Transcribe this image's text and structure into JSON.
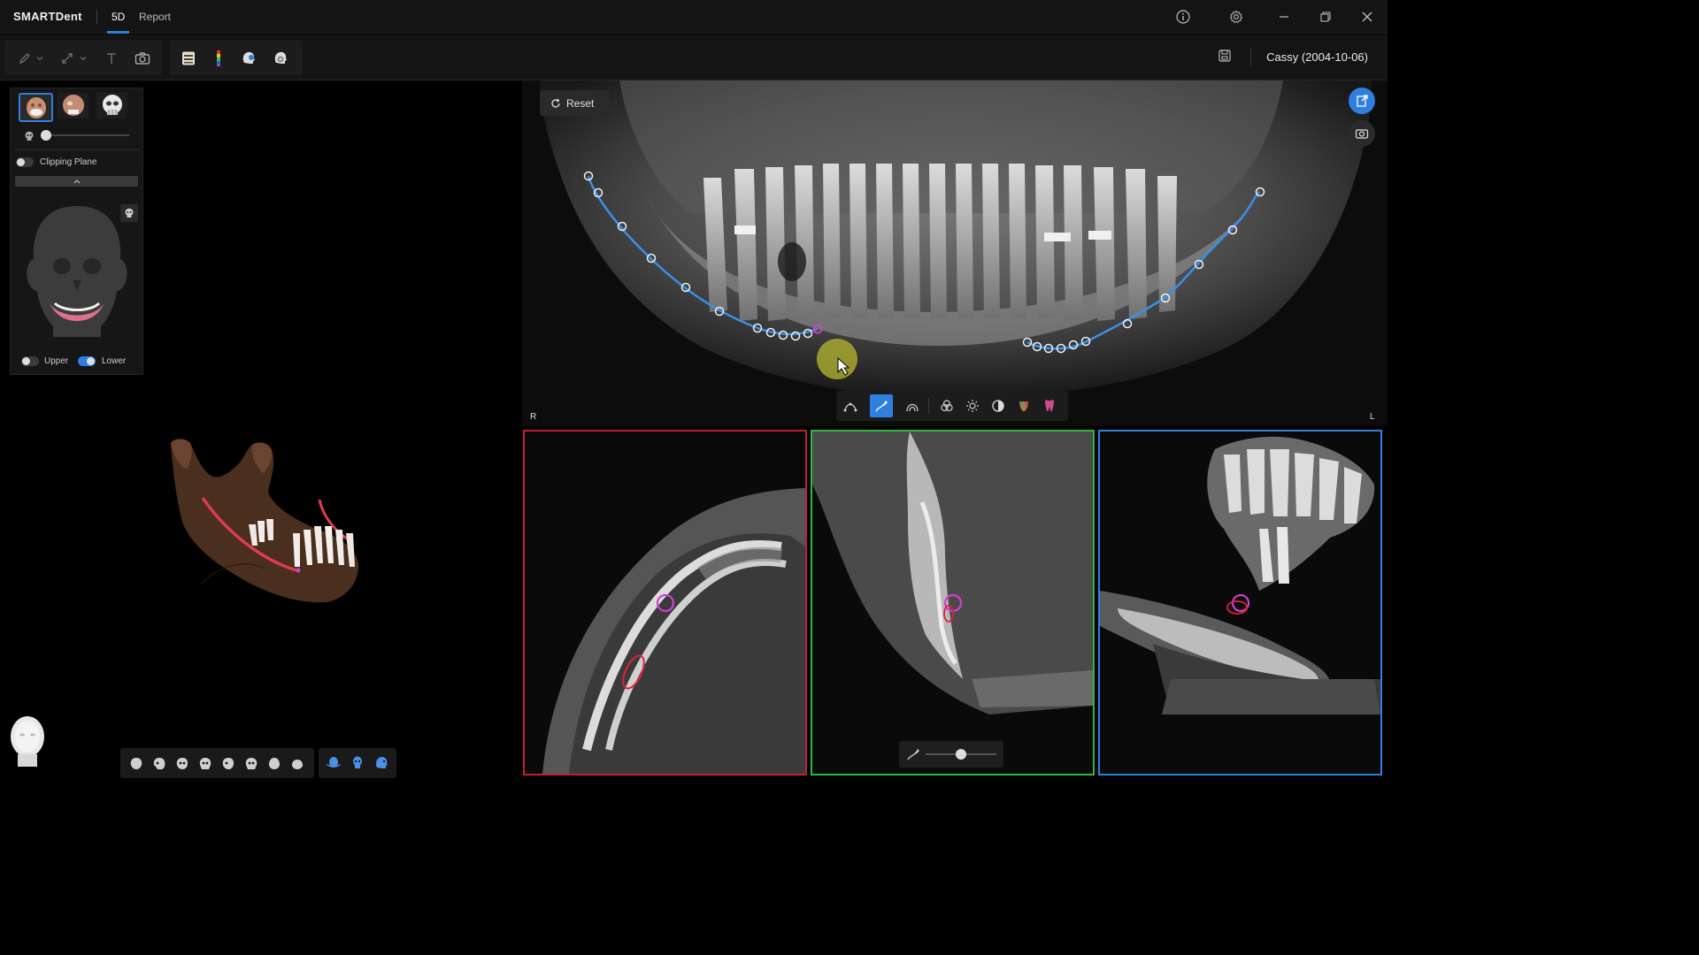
{
  "app": {
    "logo": "SMARTDent",
    "tabs": [
      {
        "label": "5D"
      },
      {
        "label": "Report"
      }
    ]
  },
  "window": {
    "controls": [
      "info-icon",
      "gear-icon",
      "minimize-icon",
      "restore-icon",
      "close-icon"
    ]
  },
  "toolbar": {
    "tools": [
      "pencil-icon",
      "chevron-down-icon",
      "measure-icon",
      "chevron-down-icon",
      "text-icon",
      "camera-icon",
      "panel-icon",
      "color-bar-icon",
      "head-scan-icon",
      "head-settings-icon"
    ],
    "patient": "Cassy (2004-10-06)"
  },
  "left_panel": {
    "clipping_plane_label": "Clipping Plane",
    "clipping_plane_on": false,
    "opacity_value": 0,
    "upper_label": "Upper",
    "upper_on": false,
    "lower_label": "Lower",
    "lower_on": true,
    "view_presets": [
      "skull-view-1-icon",
      "skull-view-2-icon",
      "skull-view-3-icon",
      "skull-view-4-icon",
      "skull-view-5-icon",
      "skull-view-6-icon",
      "skull-view-7-icon",
      "skull-view-8-icon"
    ],
    "view_modes": [
      "rotate-view-icon",
      "front-view-icon",
      "side-view-icon"
    ]
  },
  "pano": {
    "reset_label": "Reset",
    "right_marker": "R",
    "left_marker": "L",
    "tools": [
      "curve-icon",
      "nerve-draw-icon",
      "arch-icon",
      "overlay-icon",
      "brightness-icon",
      "contrast-icon",
      "color-map-icon",
      "tooth-icon"
    ],
    "active_tool": "nerve-draw-icon"
  },
  "slices": {
    "axial_color": "#c0202a",
    "cross_color": "#2fb83a",
    "coronal_color": "#2f7fe0",
    "slider_value": 0.5
  },
  "colors": {
    "accent": "#2f7fe0",
    "nerve_curve": "#3b8fe6",
    "nerve_marker": "#d040d0",
    "nerve_red": "#e0203a"
  }
}
